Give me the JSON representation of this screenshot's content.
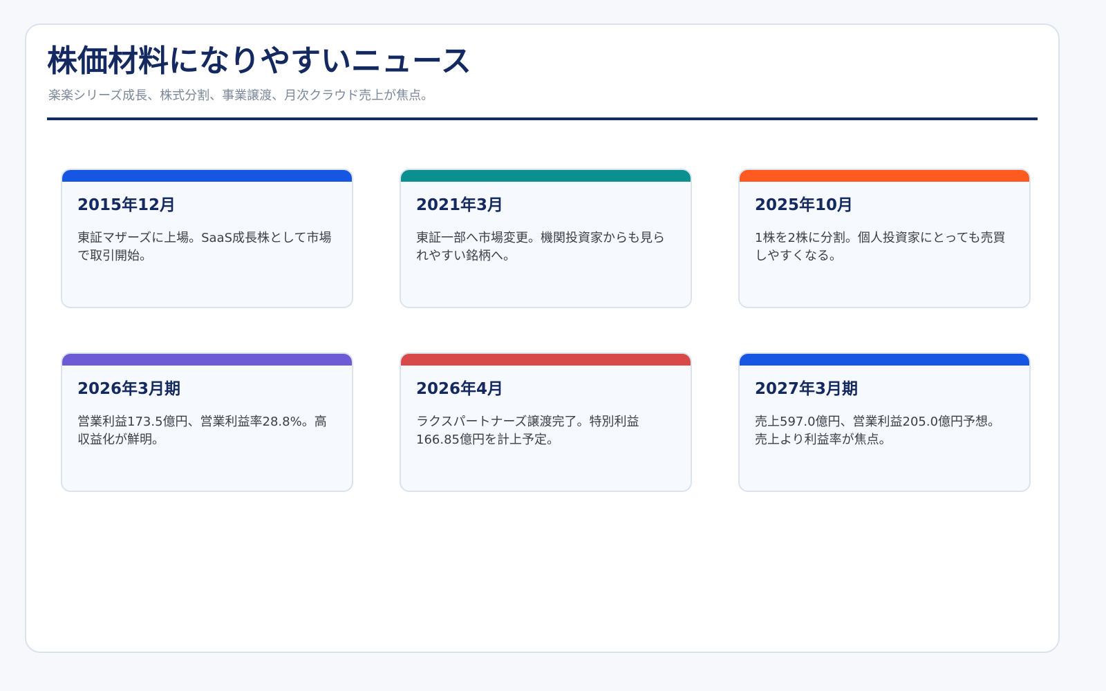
{
  "header": {
    "title": "株価材料になりやすいニュース",
    "subtitle": "楽楽シリーズ成長、株式分割、事業譲渡、月次クラウド売上が焦点。"
  },
  "events": [
    {
      "date": "2015年12月",
      "text": "東証マザーズに上場。SaaS成長株として市場で取引開始。",
      "color": "#1756e3"
    },
    {
      "date": "2021年3月",
      "text": "東証一部へ市場変更。機関投資家からも見られやすい銘柄へ。",
      "color": "#0b8f8f"
    },
    {
      "date": "2025年10月",
      "text": "1株を2株に分割。個人投資家にとっても売買しやすくなる。",
      "color": "#ff5a1f"
    },
    {
      "date": "2026年3月期",
      "text": "営業利益173.5億円、営業利益率28.8%。高収益化が鮮明。",
      "color": "#6d5bd6"
    },
    {
      "date": "2026年4月",
      "text": "ラクスパートナーズ譲渡完了。特別利益166.85億円を計上予定。",
      "color": "#d84a4a"
    },
    {
      "date": "2027年3月期",
      "text": "売上597.0億円、営業利益205.0億円予想。売上より利益率が焦点。",
      "color": "#1756e3"
    }
  ]
}
